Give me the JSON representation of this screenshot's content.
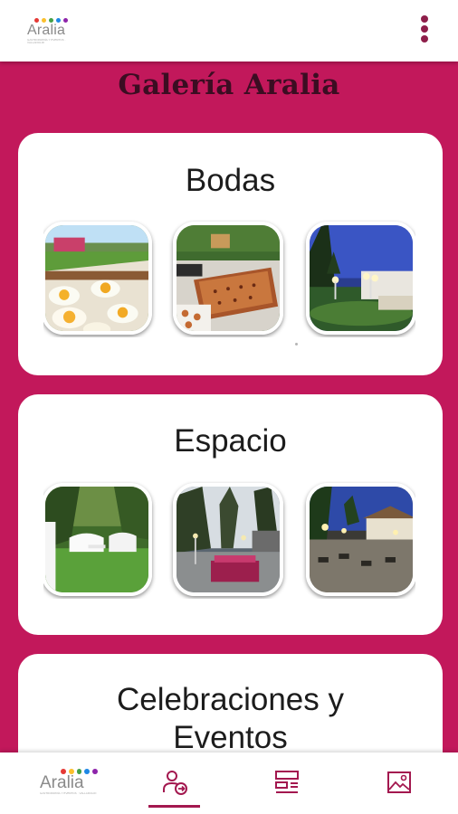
{
  "app": {
    "logo_text": "Aralia",
    "logo_tagline": "GASTRONOMÍA Y EVENTOS · VALLADOLID",
    "logo_dot_colors": [
      "#e53935",
      "#fbc02d",
      "#43a047",
      "#1e88e5",
      "#8e24aa"
    ]
  },
  "header": {
    "title": "Galería Aralia",
    "menu_icon": "more-vert-icon"
  },
  "sections": [
    {
      "title": "Bodas",
      "images": [
        "buffet-fried-eggs-photo",
        "catering-tray-photo",
        "night-garden-lamps-photo"
      ]
    },
    {
      "title": "Espacio",
      "images": [
        "garden-lounge-sofas-photo",
        "terrace-tables-evening-photo",
        "illuminated-patio-night-photo"
      ]
    },
    {
      "title": "Celebraciones y Eventos",
      "images": []
    }
  ],
  "bottom_nav": {
    "items": [
      {
        "name": "home-logo",
        "icon": "aralia-logo"
      },
      {
        "name": "contact",
        "icon": "person-arrow-icon",
        "active": true
      },
      {
        "name": "services",
        "icon": "layout-list-icon"
      },
      {
        "name": "gallery",
        "icon": "image-icon"
      }
    ],
    "active_color": "#a3184f"
  },
  "colors": {
    "background": "#c2185b",
    "accent": "#8e1e4a",
    "title": "#3b0d22"
  }
}
